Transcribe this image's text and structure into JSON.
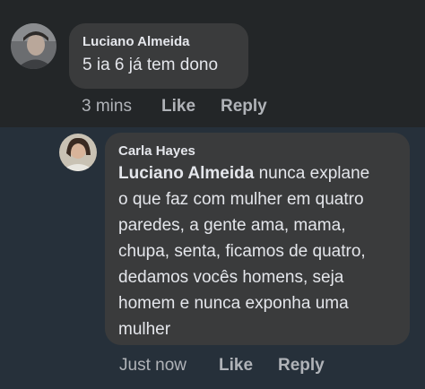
{
  "comment": {
    "author": "Luciano Almeida",
    "text": "5 ia 6 já tem dono",
    "time": "3 mins",
    "like_label": "Like",
    "reply_label": "Reply",
    "avatar_icon": "user-avatar-photo"
  },
  "reply": {
    "author": "Carla Hayes",
    "mention": "Luciano Almeida",
    "text_lines": [
      " nunca explane",
      "o que faz com mulher em quatro",
      "paredes, a gente ama, mama,",
      "chupa, senta, ficamos de quatro,",
      "dedamos vocês homens, seja",
      "homem e nunca exponha uma",
      "mulher"
    ],
    "time": "Just now",
    "like_label": "Like",
    "reply_label": "Reply",
    "avatar_icon": "user-avatar-photo"
  }
}
